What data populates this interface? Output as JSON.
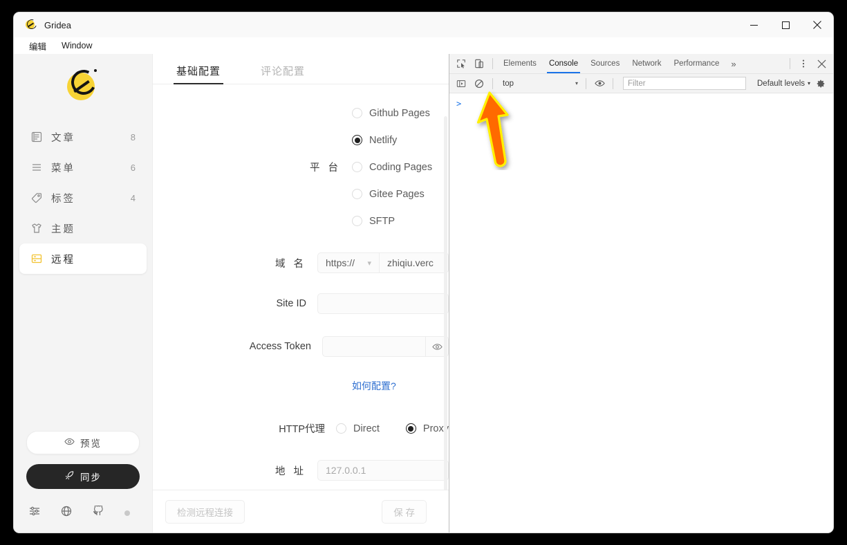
{
  "window": {
    "title": "Gridea",
    "controls": {
      "minimize": "minimize-icon",
      "maximize": "maximize-icon",
      "close": "close-icon"
    }
  },
  "menubar": {
    "items": [
      "编辑",
      "Window"
    ]
  },
  "sidebar": {
    "logo": "gridea-logo",
    "items": [
      {
        "label": "文章",
        "count": "8",
        "icon": "article-icon",
        "active": false
      },
      {
        "label": "菜单",
        "count": "6",
        "icon": "menu-icon",
        "active": false
      },
      {
        "label": "标签",
        "count": "4",
        "icon": "tag-icon",
        "active": false
      },
      {
        "label": "主题",
        "count": "",
        "icon": "theme-icon",
        "active": false
      },
      {
        "label": "远程",
        "count": "",
        "icon": "remote-icon",
        "active": true
      }
    ],
    "preview_button": "预览",
    "sync_button": "同步",
    "footer_icons": [
      "settings-sliders-icon",
      "globe-icon",
      "github-icon",
      "status-dot"
    ]
  },
  "content": {
    "tabs": [
      {
        "label": "基础配置",
        "active": true
      },
      {
        "label": "评论配置",
        "active": false
      }
    ],
    "platform": {
      "label": "平 台",
      "options": [
        {
          "label": "Github Pages",
          "selected": false
        },
        {
          "label": "Netlify",
          "selected": true
        },
        {
          "label": "Coding Pages",
          "selected": false
        },
        {
          "label": "Gitee Pages",
          "selected": false
        },
        {
          "label": "SFTP",
          "selected": false
        }
      ]
    },
    "domain": {
      "label": "域 名",
      "scheme": "https://",
      "value": "zhiqiu.verc"
    },
    "site_id": {
      "label": "Site ID",
      "value": ""
    },
    "access_token": {
      "label": "Access Token",
      "value": "",
      "eye_icon": "eye-icon"
    },
    "help_link": "如何配置?",
    "proxy": {
      "label": "HTTP代理",
      "options": [
        {
          "label": "Direct",
          "selected": false
        },
        {
          "label": "Proxy",
          "selected": true
        }
      ]
    },
    "address": {
      "label": "地 址",
      "value": "127.0.0.1"
    },
    "footer": {
      "test_button": "检测远程连接",
      "save_button": "保 存"
    }
  },
  "devtools": {
    "inspect_icon": "inspect-element-icon",
    "device_icon": "device-toolbar-icon",
    "tabs": [
      {
        "label": "Elements",
        "active": false
      },
      {
        "label": "Console",
        "active": true
      },
      {
        "label": "Sources",
        "active": false
      },
      {
        "label": "Network",
        "active": false
      },
      {
        "label": "Performance",
        "active": false
      }
    ],
    "more_tabs": "»",
    "menu_icon": "kebab-menu-icon",
    "close_icon": "close-icon",
    "toolbar": {
      "sidebar_icon": "console-sidebar-icon",
      "clear_icon": "clear-console-icon",
      "context": "top",
      "eye_icon": "live-expression-icon",
      "filter_placeholder": "Filter",
      "levels": "Default levels",
      "settings_icon": "settings-gear-icon"
    },
    "prompt": ">"
  },
  "annotation": {
    "arrow": "orange-up-arrow",
    "fill": "#FF6A00",
    "stroke": "#FFF000"
  }
}
